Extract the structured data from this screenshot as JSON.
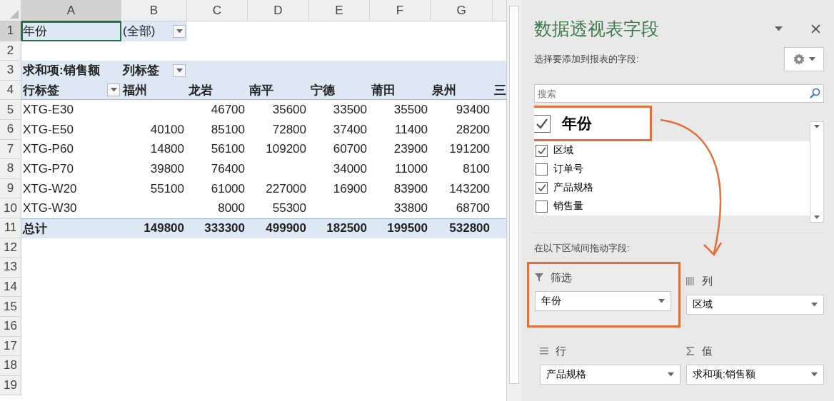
{
  "sheet": {
    "column_headers": [
      "A",
      "B",
      "C",
      "D",
      "E",
      "F",
      "G"
    ],
    "row_numbers": [
      "1",
      "2",
      "3",
      "4",
      "5",
      "6",
      "7",
      "8",
      "9",
      "10",
      "11",
      "12",
      "13",
      "14",
      "15",
      "16",
      "17",
      "18",
      "19"
    ],
    "filter": {
      "label": "年份",
      "selected": true,
      "value": "(全部)"
    },
    "pivot": {
      "value_label": "求和项:销售额",
      "column_label": "列标签",
      "row_label": "行标签",
      "columns": [
        "福州",
        "龙岩",
        "南平",
        "宁德",
        "莆田",
        "泉州",
        "三"
      ],
      "rows": [
        {
          "label": "XTG-E30",
          "values": {
            "C": "46700",
            "D": "35600",
            "E": "33500",
            "F": "35500",
            "G": "93400"
          }
        },
        {
          "label": "XTG-E50",
          "values": {
            "B": "40100",
            "C": "85100",
            "D": "72800",
            "E": "37400",
            "F": "11400",
            "G": "28200"
          }
        },
        {
          "label": "XTG-P60",
          "values": {
            "B": "14800",
            "C": "56100",
            "D": "109200",
            "E": "60700",
            "F": "23900",
            "G": "191200"
          }
        },
        {
          "label": "XTG-P70",
          "values": {
            "B": "39800",
            "C": "76400",
            "E": "34000",
            "F": "11000",
            "G": "8100"
          }
        },
        {
          "label": "XTG-W20",
          "values": {
            "B": "55100",
            "C": "61000",
            "D": "227000",
            "E": "16900",
            "F": "83900",
            "G": "143200"
          }
        },
        {
          "label": "XTG-W30",
          "values": {
            "C": "8000",
            "D": "55300",
            "F": "33800",
            "G": "68700"
          }
        }
      ],
      "total": {
        "label": "总计",
        "values": [
          "149800",
          "333300",
          "499900",
          "182500",
          "199500",
          "532800"
        ]
      }
    }
  },
  "panel": {
    "title": "数据透视表字段",
    "field_prompt": "选择要添加到报表的字段:",
    "search": {
      "placeholder": "搜索"
    },
    "fields": [
      {
        "label": "年份",
        "checked": true,
        "highlighted": true
      },
      {
        "label": "区域",
        "checked": true,
        "highlighted": false
      },
      {
        "label": "订单号",
        "checked": false,
        "highlighted": false
      },
      {
        "label": "产品规格",
        "checked": true,
        "highlighted": false
      },
      {
        "label": "销售量",
        "checked": false,
        "highlighted": false
      }
    ],
    "areas_prompt": "在以下区域间拖动字段:",
    "areas": [
      {
        "kind": "filter",
        "label": "筛选",
        "field": "年份",
        "highlighted": true
      },
      {
        "kind": "columns",
        "label": "列",
        "field": "区域",
        "highlighted": false
      },
      {
        "kind": "rows",
        "label": "行",
        "field": "产品规格",
        "highlighted": false
      },
      {
        "kind": "values",
        "label": "值",
        "field": "求和项:销售额",
        "highlighted": false
      }
    ]
  }
}
